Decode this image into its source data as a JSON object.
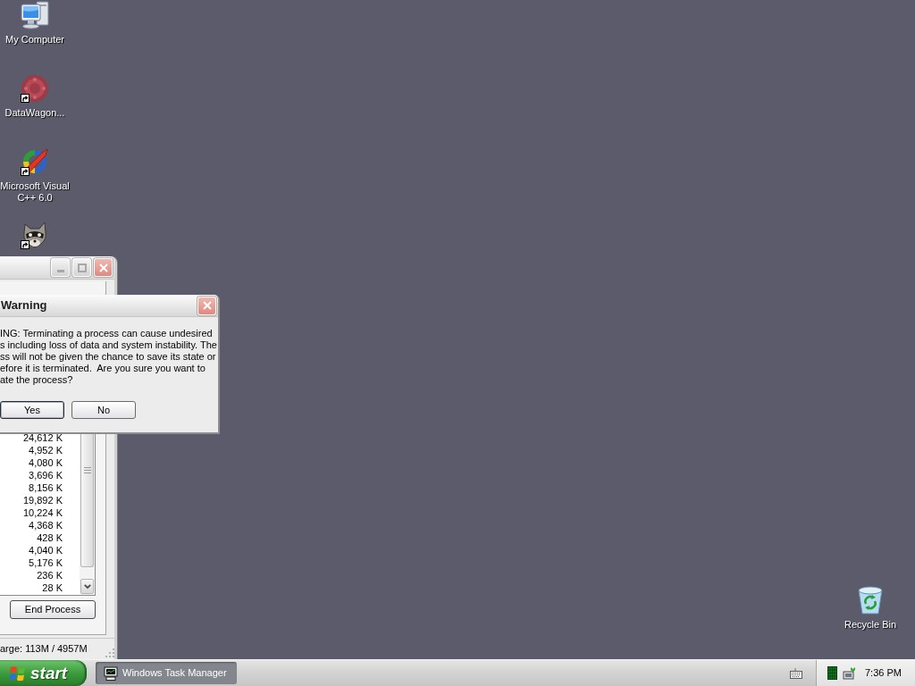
{
  "desktop": {
    "icons": [
      {
        "kind": "computer",
        "label": "My Computer",
        "shortcut": false
      },
      {
        "kind": "emblem",
        "label": "DataWagon...",
        "shortcut": true
      },
      {
        "kind": "ring",
        "label": "Microsoft Visual C++ 6.0",
        "shortcut": true
      },
      {
        "kind": "raccoon",
        "shortcut": true
      }
    ],
    "recycle_bin": {
      "label": "Recycle Bin"
    }
  },
  "task_manager": {
    "memory_usage": [
      "24,612 K",
      "4,952 K",
      "4,080 K",
      "3,696 K",
      "8,156 K",
      "19,892 K",
      "10,224 K",
      "4,368 K",
      "428 K",
      "4,040 K",
      "5,176 K",
      "236 K",
      "28 K"
    ],
    "end_process_button": "End Process",
    "status_text": "arge: 113M / 4957M"
  },
  "warning_dialog": {
    "title": "Warning",
    "message_lines": [
      "ING: Terminating a process can cause undesired",
      "s including loss of data and system instability. The",
      "ss will not be given the chance to save its state or",
      "efore it is terminated.  Are you sure you want to",
      "ate the process?"
    ],
    "buttons": [
      {
        "label": "Yes",
        "default": true
      },
      {
        "label": "No",
        "default": false
      }
    ]
  },
  "taskbar": {
    "start_button": "start",
    "tasks": [
      {
        "label": "Windows Task Manager",
        "selected": true
      }
    ],
    "clock": "7:36 PM"
  }
}
